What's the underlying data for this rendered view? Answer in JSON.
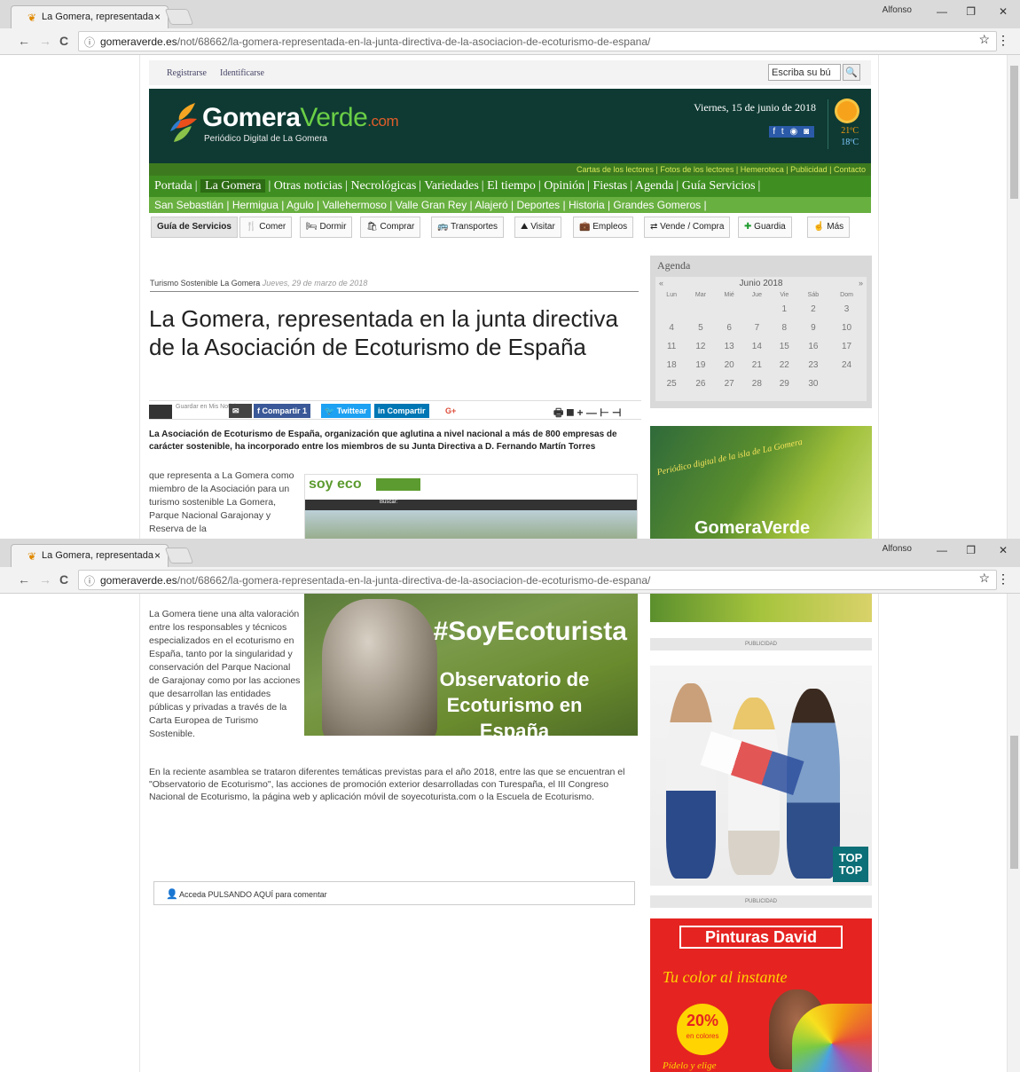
{
  "tab": {
    "title": "La Gomera, representada",
    "close": "×"
  },
  "window": {
    "profile": "Alfonso",
    "min": "—",
    "max": "❐",
    "close": "✕"
  },
  "address": {
    "back": "←",
    "forward": "→",
    "reload": "C",
    "info": "ⓘ",
    "domain": "gomeraverde.es",
    "path": "/not/68662/la-gomera-representada-en-la-junta-directiva-de-la-asociacion-de-ecoturismo-de-espana/",
    "star": "☆",
    "menu": "⋮"
  },
  "site": {
    "register": "Registrarse",
    "login": "Identificarse",
    "search_placeholder": "Escriba su bú",
    "search_icon": "🔍",
    "logo_main": "Gomera",
    "logo_verde": "Verde",
    "logo_com": ".com",
    "tagline": "Periódico Digital de La Gomera",
    "date": "Viernes, 15 de junio de 2018",
    "social": "f t ◉ ◙",
    "temp_max": "21ºC",
    "temp_min": "18ºC",
    "minilinks": "Cartas de los lectores | Fotos de los lectores | Hemeroteca | Publicidad | Contacto",
    "menu1": [
      "Portada",
      "La Gomera",
      "Otras noticias",
      "Necrológicas",
      "Variedades",
      "El tiempo",
      "Opinión",
      "Fiestas",
      "Agenda",
      "Guía Servicios"
    ],
    "menu2": "San Sebastián | Hermigua | Agulo | Vallehermoso | Valle Gran Rey | Alajeró | Deportes | Historia | Grandes Gomeros |",
    "guia": [
      "Guía de Servicios",
      "Comer",
      "Dormir",
      "Comprar",
      "Transportes",
      "Visitar",
      "Empleos",
      "Vende / Compra",
      "Guardia",
      "Más"
    ]
  },
  "article": {
    "section": "Turismo Sostenible La Gomera",
    "date": "Jueves, 29 de marzo de 2018",
    "title": "La Gomera, representada en la junta directiva de la Asociación de Ecoturismo de España",
    "share_mis": "Guardar en Mis Noticias",
    "share_fb": "f  Compartir 1",
    "share_tw": "🐦 Twittear",
    "share_in": "in  Compartir",
    "share_g": "G+",
    "tools": "🖶 ◼ + — ⊢ ⊣",
    "lead": "La Asociación de Ecoturismo de España, organización que aglutina a nivel nacional a más de 800 empresas de carácter sostenible, ha incorporado entre los miembros de su Junta Directiva a D. Fernando Martín Torres",
    "p1_top": "que representa a La Gomera como miembro de la Asociación para un turismo sostenible La Gomera, Parque Nacional Garajonay y Reserva de la",
    "p1_bottom": "La Gomera tiene una alta valoración entre los responsables y técnicos especializados en el ecoturismo en España, tanto por la singularidad y conservación del Parque Nacional de Garajonay como por las acciones que desarrollan las entidades públicas y privadas a través de la Carta Europea de Turismo Sostenible.",
    "p2": "En la reciente asamblea se trataron diferentes temáticas previstas para el año 2018, entre las que se encuentran el \"Observatorio de Ecoturismo\", las acciones de promoción exterior desarrolladas con Turespaña, el III Congreso Nacional de Ecoturismo, la página web y aplicación móvil de soyecoturista.com o la Escuela de Ecoturismo.",
    "img_hashtag": "#SoyEcoturista",
    "img_obs": "Observatorio de Ecoturismo en España",
    "soyeco_logo": "soy eco",
    "soyeco_buscar": "Buscar:",
    "comment": "Acceda PULSANDO AQUÍ para comentar"
  },
  "agenda": {
    "title": "Agenda",
    "month": "Junio 2018",
    "prev": "«",
    "next": "»",
    "days": [
      "Lun",
      "Mar",
      "Mié",
      "Jue",
      "Vie",
      "Sáb",
      "Dom"
    ],
    "weeks": [
      [
        "",
        "",
        "",
        "",
        "1",
        "2",
        "3"
      ],
      [
        "4",
        "5",
        "6",
        "7",
        "8",
        "9",
        "10"
      ],
      [
        "11",
        "12",
        "13",
        "14",
        "15",
        "16",
        "17"
      ],
      [
        "18",
        "19",
        "20",
        "21",
        "22",
        "23",
        "24"
      ],
      [
        "25",
        "26",
        "27",
        "28",
        "29",
        "30",
        ""
      ]
    ]
  },
  "ads": {
    "ad1_text": "Periódico digital de la isla de La Gomera",
    "ad1_logo": "GomeraVerde",
    "pub_label": "PUBLICIDAD",
    "toptop": "TOP TOP",
    "pinturas_title": "Pinturas David",
    "pinturas_slogan": "Tu color al instante",
    "pinturas_pct": "20%",
    "pinturas_small": "en colores",
    "pinturas_footer": "Pídelo y elige"
  }
}
